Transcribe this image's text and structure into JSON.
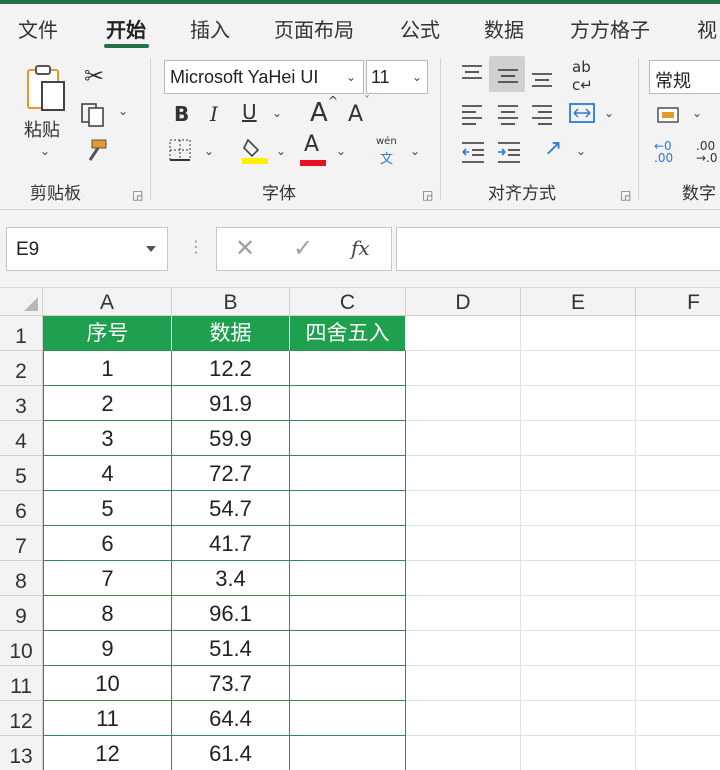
{
  "tabs": [
    "文件",
    "开始",
    "插入",
    "页面布局",
    "公式",
    "数据",
    "方方格子",
    "视"
  ],
  "active_tab": "开始",
  "clipboard": {
    "paste_label": "粘贴",
    "group_label": "剪贴板"
  },
  "font": {
    "name": "Microsoft YaHei UI",
    "size": "11",
    "group_label": "字体",
    "bold": "B",
    "italic": "I",
    "underline": "U",
    "grow": "A",
    "shrink": "A",
    "color_letter": "A",
    "phonetic_top": "wén",
    "phonetic_bottom": "文"
  },
  "alignment": {
    "group_label": "对齐方式"
  },
  "number": {
    "format": "常规",
    "group_label": "数字"
  },
  "formula_bar": {
    "name_box": "E9",
    "fx": "fx",
    "formula": ""
  },
  "columns": [
    "A",
    "B",
    "C",
    "D",
    "E",
    "F"
  ],
  "rows": [
    "1",
    "2",
    "3",
    "4",
    "5",
    "6",
    "7",
    "8",
    "9",
    "10",
    "11",
    "12",
    "13"
  ],
  "table": {
    "headers": [
      "序号",
      "数据",
      "四舍五入"
    ],
    "data": [
      [
        "1",
        "12.2",
        ""
      ],
      [
        "2",
        "91.9",
        ""
      ],
      [
        "3",
        "59.9",
        ""
      ],
      [
        "4",
        "72.7",
        ""
      ],
      [
        "5",
        "54.7",
        ""
      ],
      [
        "6",
        "41.7",
        ""
      ],
      [
        "7",
        "3.4",
        ""
      ],
      [
        "8",
        "96.1",
        ""
      ],
      [
        "9",
        "51.4",
        ""
      ],
      [
        "10",
        "73.7",
        ""
      ],
      [
        "11",
        "64.4",
        ""
      ],
      [
        "12",
        "61.4",
        ""
      ]
    ]
  },
  "colors": {
    "accent": "#217346",
    "header_fill": "#1fa04e",
    "header_text": "#ffffff",
    "font_color_bar": "#e81123",
    "highlight_bar": "#ffef00"
  }
}
